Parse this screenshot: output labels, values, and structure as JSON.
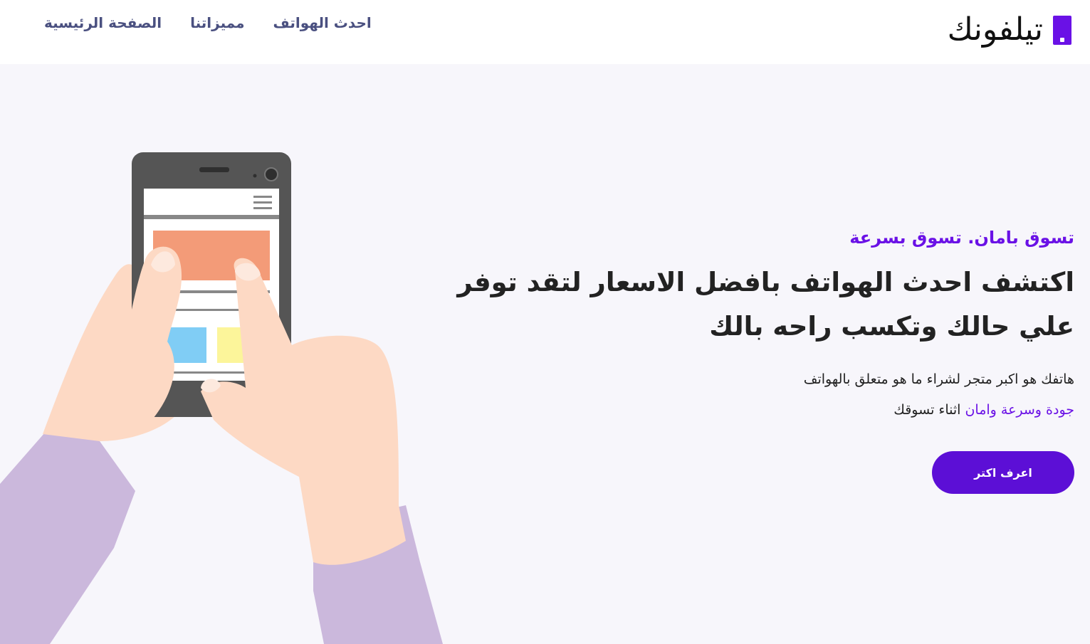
{
  "brand": {
    "name": "تيلفونك",
    "icon": "brand-square-icon",
    "color": "#6a11e6"
  },
  "nav": {
    "items": [
      {
        "label": "الصفحة الرئيسية"
      },
      {
        "label": "مميزاتنا"
      },
      {
        "label": "احدث الهواتف"
      }
    ]
  },
  "hero": {
    "tagline": "تسوق بامان. تسوق بسرعة",
    "headline": "اكتشف احدث الهواتف بافضل الاسعار لتقد توفر علي حالك وتكسب راحه بالك",
    "description_line1": "هاتفك هو اكبر متجر لشراء ما هو متعلق بالهواتف",
    "description_accent": "جودة وسرعة وامان",
    "description_rest": "اثناء تسوقك",
    "cta_label": "اعرف اكتر",
    "illustration": "hands-holding-phone-illustration"
  },
  "colors": {
    "accent": "#6a11e6",
    "cta_bg": "#5c0fd6",
    "nav_text": "#4a5080",
    "page_bg": "#f7f6fb"
  }
}
